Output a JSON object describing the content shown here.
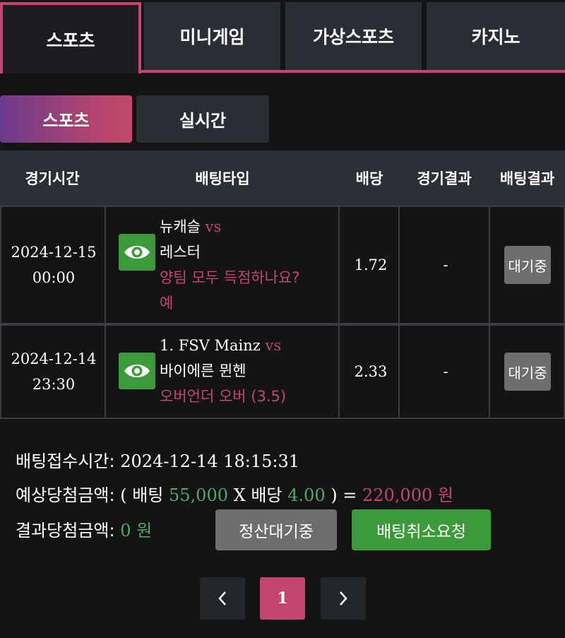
{
  "top_tabs": [
    {
      "label": "스포츠",
      "active": true
    },
    {
      "label": "미니게임",
      "active": false
    },
    {
      "label": "가상스포츠",
      "active": false
    },
    {
      "label": "카지노",
      "active": false
    }
  ],
  "sub_tabs": [
    {
      "label": "스포츠",
      "active": true
    },
    {
      "label": "실시간",
      "active": false
    }
  ],
  "table": {
    "headers": [
      "경기시간",
      "배팅타입",
      "배당",
      "경기결과",
      "배팅결과"
    ],
    "rows": [
      {
        "date": "2024-12-15",
        "time": "00:00",
        "home": "뉴캐슬",
        "vs": "vs",
        "away": "레스터",
        "market": "양팀 모두 득점하나요?",
        "pick": "예",
        "odds": "1.72",
        "result": "-",
        "status": "대기중"
      },
      {
        "date": "2024-12-14",
        "time": "23:30",
        "home": "1. FSV Mainz",
        "vs": "vs",
        "away": "바이에른 뮌헨",
        "market": "오버언더 오버 (3.5)",
        "pick": "",
        "odds": "2.33",
        "result": "-",
        "status": "대기중"
      }
    ]
  },
  "summary": {
    "received_label": "배팅접수시간:",
    "received_value": "2024-12-14 18:15:31",
    "expected_label": "예상당첨금액:",
    "open_paren": "( 배팅",
    "stake": "55,000",
    "x_text": "X 배당",
    "total_odds": "4.00",
    "close_eq": ") =",
    "expected_amount": "220,000 원",
    "actual_label": "결과당첨금액:",
    "actual_amount": "0 원",
    "settle_wait_label": "정산대기중",
    "cancel_request_label": "배팅취소요청"
  },
  "pagination": {
    "prev": "‹",
    "current": "1",
    "next": "›"
  },
  "colors": {
    "accent": "#c2466f",
    "green": "#3d9a3a",
    "bg": "#141414"
  }
}
